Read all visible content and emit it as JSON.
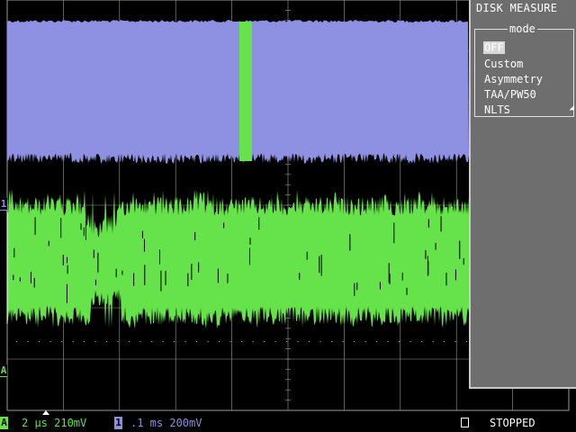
{
  "menu": {
    "title": "DISK MEASURE",
    "group_label": "mode",
    "items": [
      {
        "label": "OFF",
        "selected": true
      },
      {
        "label": "Custom",
        "selected": false
      },
      {
        "label": "Asymmetry",
        "selected": false
      },
      {
        "label": "TAA/PW50",
        "selected": false
      },
      {
        "label": "NLTS",
        "selected": false
      }
    ]
  },
  "traces": {
    "channel_1_color": "#8e90e2",
    "channel_a_color": "#66e24a",
    "grid_color": "#9a9a9a"
  },
  "markers": {
    "channel_1": "1",
    "channel_a": "A"
  },
  "status": {
    "channel_a_badge": "A",
    "channel_a_settings": "2 µs 210mV",
    "channel_1_badge": "1",
    "channel_1_settings": ".1 ms 200mV",
    "run_state": "STOPPED"
  }
}
